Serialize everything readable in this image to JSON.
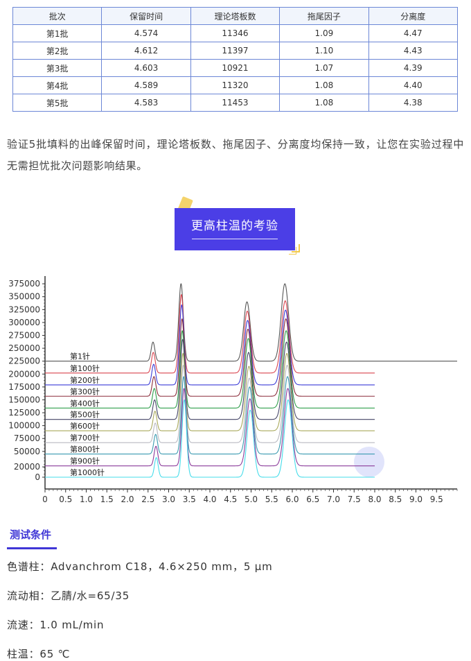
{
  "table": {
    "headers": [
      "批次",
      "保留时间",
      "理论塔板数",
      "拖尾因子",
      "分离度"
    ],
    "rows": [
      [
        "第1批",
        "4.574",
        "11346",
        "1.09",
        "4.47"
      ],
      [
        "第2批",
        "4.612",
        "11397",
        "1.10",
        "4.43"
      ],
      [
        "第3批",
        "4.603",
        "10921",
        "1.07",
        "4.39"
      ],
      [
        "第4批",
        "4.589",
        "11320",
        "1.08",
        "4.40"
      ],
      [
        "第5批",
        "4.583",
        "11453",
        "1.08",
        "4.38"
      ]
    ]
  },
  "paragraph": "验证5批填料的出峰保留时间，理论塔板数、拖尾因子、分离度均保持一致，让您在实验过程中无需担忧批次问题影响结果。",
  "section_heading": "更高柱温的考验",
  "colors": {
    "accent": "#4b3ee6",
    "table_border": "#6b86d6",
    "deco_yellow": "#f4d36b"
  },
  "chart_data": {
    "type": "line",
    "title": "",
    "xlabel": "",
    "ylabel": "",
    "xlim": [
      0,
      10
    ],
    "ylim": [
      0,
      390000
    ],
    "x_ticks": [
      "0",
      "0.5",
      "1.0",
      "1.5",
      "2.0",
      "2.5",
      "3.0",
      "3.5",
      "4.0",
      "4.5",
      "5.0",
      "5.5",
      "6.0",
      "6.5",
      "7.0",
      "7.5",
      "8.0",
      "8.5",
      "9.0",
      "9.5"
    ],
    "y_ticks": [
      "0",
      "20000",
      "50000",
      "75000",
      "100000",
      "125000",
      "150000",
      "175000",
      "200000",
      "225000",
      "250000",
      "275000",
      "300000",
      "325000",
      "350000",
      "375000"
    ],
    "y_tick_values": [
      0,
      20000,
      50000,
      75000,
      100000,
      125000,
      150000,
      175000,
      200000,
      225000,
      250000,
      275000,
      300000,
      325000,
      350000,
      375000
    ],
    "peaks": [
      {
        "rt": 2.7,
        "width": 0.045
      },
      {
        "rt": 3.38,
        "width": 0.055
      },
      {
        "rt": 4.98,
        "width": 0.08
      },
      {
        "rt": 5.9,
        "width": 0.09
      }
    ],
    "series": [
      {
        "name": "第1针",
        "baseline": 225000,
        "x_end": 10.0,
        "color": "#555555",
        "peak_heights": [
          37000,
          150000,
          115000,
          150000
        ]
      },
      {
        "name": "第100针",
        "baseline": 202000,
        "x_end": 8.0,
        "color": "#d9444f",
        "peak_heights": [
          40000,
          152000,
          120000,
          140000
        ]
      },
      {
        "name": "第200针",
        "baseline": 179000,
        "x_end": 8.0,
        "color": "#3b3bd6",
        "peak_heights": [
          40000,
          155000,
          125000,
          145000
        ]
      },
      {
        "name": "第300针",
        "baseline": 157000,
        "x_end": 8.0,
        "color": "#8a2c3a",
        "peak_heights": [
          38000,
          150000,
          130000,
          150000
        ]
      },
      {
        "name": "第400针",
        "baseline": 134000,
        "x_end": 8.0,
        "color": "#2e9e4a",
        "peak_heights": [
          38000,
          150000,
          135000,
          150000
        ]
      },
      {
        "name": "第500针",
        "baseline": 112000,
        "x_end": 8.0,
        "color": "#444466",
        "peak_heights": [
          38000,
          155000,
          130000,
          150000
        ]
      },
      {
        "name": "第600针",
        "baseline": 90000,
        "x_end": 8.0,
        "color": "#a8a85a",
        "peak_heights": [
          38000,
          150000,
          125000,
          150000
        ]
      },
      {
        "name": "第700针",
        "baseline": 67000,
        "x_end": 8.0,
        "color": "#b8b8c0",
        "peak_heights": [
          38000,
          150000,
          125000,
          150000
        ]
      },
      {
        "name": "第800针",
        "baseline": 45000,
        "x_end": 8.0,
        "color": "#3a9ab0",
        "peak_heights": [
          38000,
          150000,
          130000,
          150000
        ]
      },
      {
        "name": "第900针",
        "baseline": 22000,
        "x_end": 8.0,
        "color": "#8a3a9a",
        "peak_heights": [
          38000,
          150000,
          130000,
          150000
        ]
      },
      {
        "name": "第1000针",
        "baseline": 0,
        "x_end": 8.0,
        "color": "#44dcea",
        "peak_heights": [
          38000,
          150000,
          130000,
          150000
        ]
      }
    ]
  },
  "conditions": {
    "title": "测试条件",
    "column": "色谱柱：Advanchrom C18，4.6×250 mm，5 μm",
    "mobile_phase": "流动相：乙腈/水=65/35",
    "flow_rate": "流速：1.0 mL/min",
    "temperature": "柱温：65 ℃"
  }
}
